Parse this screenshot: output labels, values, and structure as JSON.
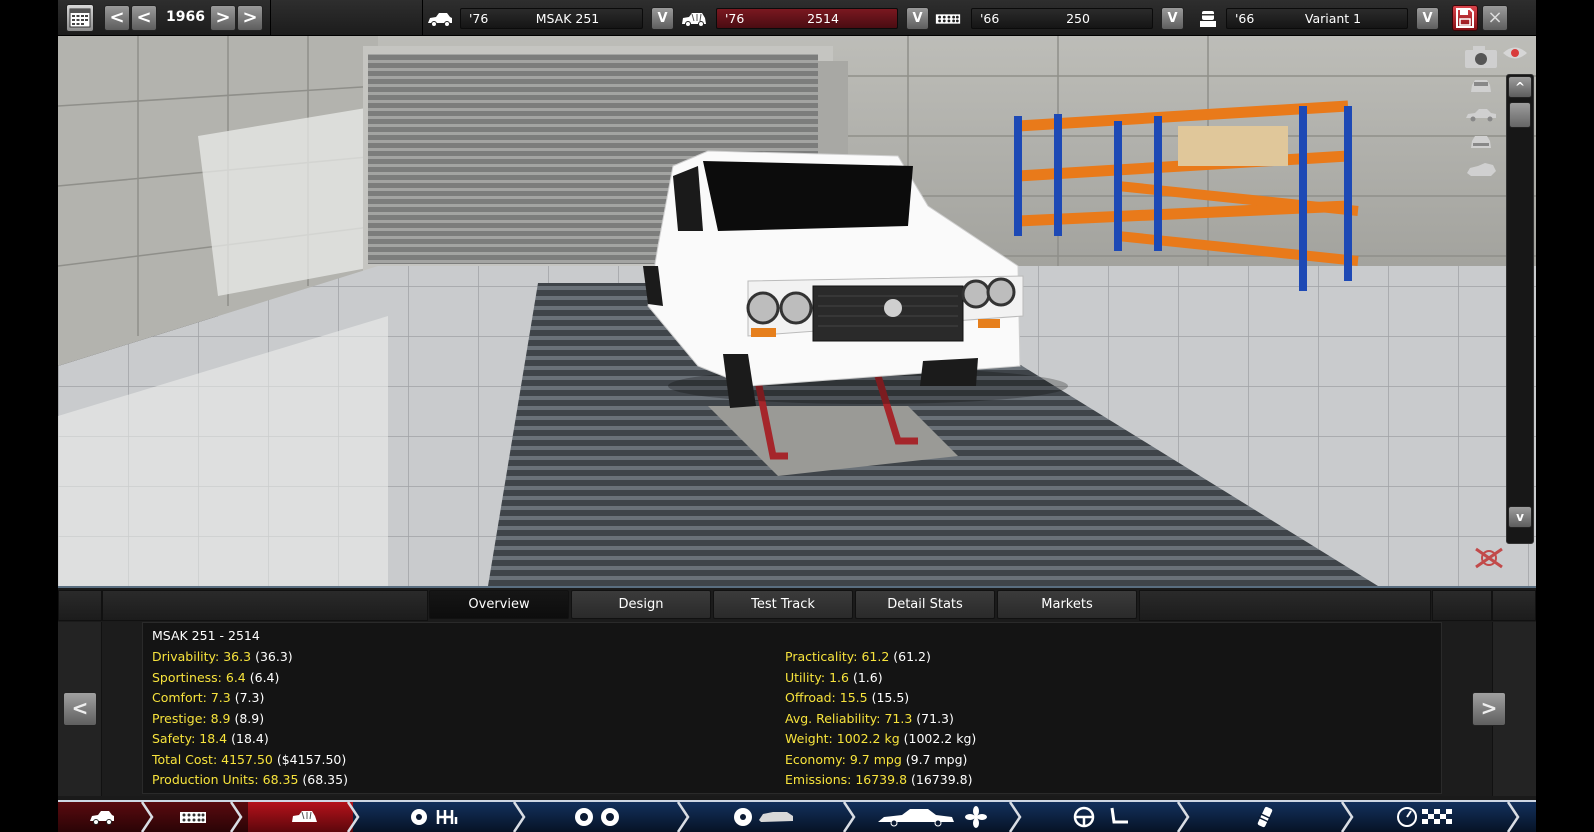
{
  "toolbar": {
    "year": "1966",
    "model": {
      "year": "'76",
      "name": "MSAK 251"
    },
    "trim": {
      "year": "'76",
      "name": "2514"
    },
    "engine_family": {
      "year": "'66",
      "name": "250"
    },
    "engine_variant": {
      "year": "'66",
      "name": "Variant 1"
    },
    "prev_label": "<",
    "next_label": ">",
    "dropdown_label": "V",
    "close_label": "×"
  },
  "viewport": {
    "scroll_up": "^",
    "scroll_down": "v"
  },
  "tabs": [
    {
      "label": "Overview",
      "active": true
    },
    {
      "label": "Design",
      "active": false
    },
    {
      "label": "Test Track",
      "active": false
    },
    {
      "label": "Detail Stats",
      "active": false
    },
    {
      "label": "Markets",
      "active": false
    }
  ],
  "stats": {
    "title": "MSAK 251 - 2514",
    "left": [
      {
        "key": "Drivability:",
        "value": "36.3",
        "prev": "(36.3)"
      },
      {
        "key": "Sportiness:",
        "value": "6.4",
        "prev": "(6.4)"
      },
      {
        "key": "Comfort:",
        "value": "7.3",
        "prev": "(7.3)"
      },
      {
        "key": "Prestige:",
        "value": "8.9",
        "prev": "(8.9)"
      },
      {
        "key": "Safety:",
        "value": "18.4",
        "prev": "(18.4)"
      },
      {
        "key": "Total Cost:",
        "value": "4157.50",
        "prev": "($4157.50)"
      },
      {
        "key": "Production Units:",
        "value": "68.35",
        "prev": "(68.35)"
      }
    ],
    "right": [
      {
        "key": "Practicality:",
        "value": "61.2",
        "prev": "(61.2)"
      },
      {
        "key": "Utility:",
        "value": "1.6",
        "prev": "(1.6)"
      },
      {
        "key": "Offroad:",
        "value": "15.5",
        "prev": "(15.5)"
      },
      {
        "key": "Avg. Reliability:",
        "value": "71.3",
        "prev": "(71.3)"
      },
      {
        "key": "Weight:",
        "value": "1002.2 kg",
        "prev": "(1002.2 kg)"
      },
      {
        "key": "Economy:",
        "value": "9.7 mpg",
        "prev": "(9.7 mpg)"
      },
      {
        "key": "Emissions:",
        "value": "16739.8",
        "prev": "(16739.8)"
      }
    ],
    "prev_label": "<",
    "next_label": ">"
  },
  "bottom_nav": [
    {
      "icon": "car-model-icon",
      "state": "red"
    },
    {
      "icon": "engine-block-icon",
      "state": "red"
    },
    {
      "icon": "trim-icon",
      "state": "active-red"
    },
    {
      "icon": "gearbox-icon",
      "state": "blue"
    },
    {
      "icon": "wheels-icon",
      "state": "blue"
    },
    {
      "icon": "brakes-icon",
      "state": "blue"
    },
    {
      "icon": "body-fan-icon",
      "state": "blue"
    },
    {
      "icon": "interior-icon",
      "state": "blue"
    },
    {
      "icon": "testing-icon",
      "state": "blue"
    },
    {
      "icon": "finish-flag-icon",
      "state": "blue"
    }
  ],
  "colors": {
    "stat_yellow": "#f7e33c",
    "save_red": "#c0272f",
    "nav_blue": "#0b1a33",
    "nav_red": "#7d0b12"
  }
}
